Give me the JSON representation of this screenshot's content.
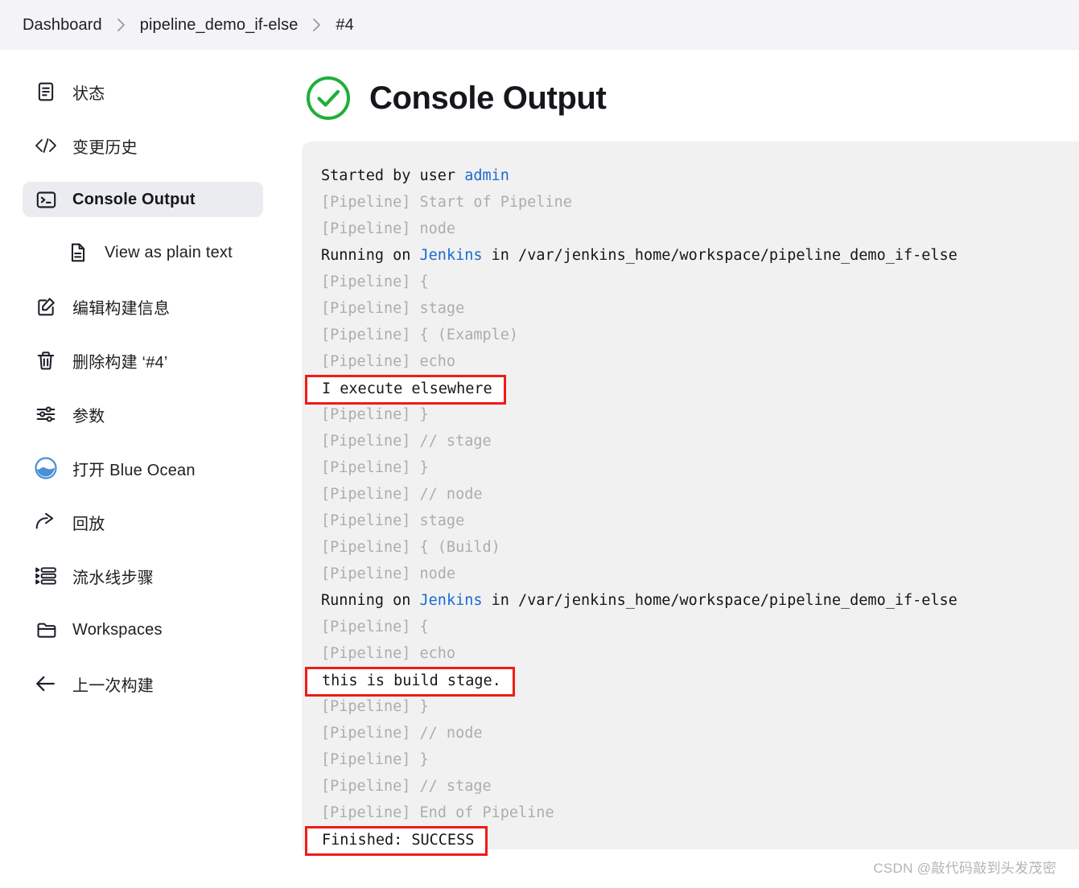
{
  "breadcrumb": {
    "items": [
      {
        "label": "Dashboard"
      },
      {
        "label": "pipeline_demo_if-else"
      },
      {
        "label": "#4"
      }
    ],
    "separator_icon": "chevron-right-icon"
  },
  "sidebar": {
    "items": [
      {
        "id": "status",
        "label": "状态",
        "icon": "document-icon",
        "selected": false,
        "sub": false
      },
      {
        "id": "changes",
        "label": "变更历史",
        "icon": "code-icon",
        "selected": false,
        "sub": false
      },
      {
        "id": "console",
        "label": "Console Output",
        "icon": "terminal-icon",
        "selected": true,
        "sub": false
      },
      {
        "id": "plaintext",
        "label": "View as plain text",
        "icon": "file-text-icon",
        "selected": false,
        "sub": true
      },
      {
        "id": "edit-build",
        "label": "编辑构建信息",
        "icon": "edit-icon",
        "selected": false,
        "sub": false
      },
      {
        "id": "delete-build",
        "label": "删除构建 ‘#4’",
        "icon": "trash-icon",
        "selected": false,
        "sub": false
      },
      {
        "id": "parameters",
        "label": "参数",
        "icon": "sliders-icon",
        "selected": false,
        "sub": false
      },
      {
        "id": "blue-ocean",
        "label": "打开 Blue Ocean",
        "icon": "blue-ocean-icon",
        "selected": false,
        "sub": false
      },
      {
        "id": "replay",
        "label": "回放",
        "icon": "replay-icon",
        "selected": false,
        "sub": false
      },
      {
        "id": "pipeline-steps",
        "label": "流水线步骤",
        "icon": "steps-icon",
        "selected": false,
        "sub": false
      },
      {
        "id": "workspaces",
        "label": "Workspaces",
        "icon": "folder-icon",
        "selected": false,
        "sub": false
      },
      {
        "id": "prev-build",
        "label": "上一次构建",
        "icon": "arrow-left-icon",
        "selected": false,
        "sub": false
      }
    ]
  },
  "main": {
    "title": "Console Output",
    "status_icon": "success-check-circle-icon",
    "status_color": "#1faf38"
  },
  "console": {
    "lines": [
      {
        "segments": [
          {
            "text": "Started by user ",
            "style": "normal"
          },
          {
            "text": "admin",
            "style": "link"
          }
        ],
        "boxed": false
      },
      {
        "segments": [
          {
            "text": "[Pipeline] Start of Pipeline",
            "style": "dim"
          }
        ],
        "boxed": false
      },
      {
        "segments": [
          {
            "text": "[Pipeline] node",
            "style": "dim"
          }
        ],
        "boxed": false
      },
      {
        "segments": [
          {
            "text": "Running on ",
            "style": "normal"
          },
          {
            "text": "Jenkins",
            "style": "link"
          },
          {
            "text": " in /var/jenkins_home/workspace/pipeline_demo_if-else",
            "style": "normal"
          }
        ],
        "boxed": false
      },
      {
        "segments": [
          {
            "text": "[Pipeline] {",
            "style": "dim"
          }
        ],
        "boxed": false
      },
      {
        "segments": [
          {
            "text": "[Pipeline] stage",
            "style": "dim"
          }
        ],
        "boxed": false
      },
      {
        "segments": [
          {
            "text": "[Pipeline] { (Example)",
            "style": "dim"
          }
        ],
        "boxed": false
      },
      {
        "segments": [
          {
            "text": "[Pipeline] echo",
            "style": "dim"
          }
        ],
        "boxed": false
      },
      {
        "segments": [
          {
            "text": "I execute elsewhere",
            "style": "normal"
          }
        ],
        "boxed": true
      },
      {
        "segments": [
          {
            "text": "[Pipeline] }",
            "style": "dim"
          }
        ],
        "boxed": false
      },
      {
        "segments": [
          {
            "text": "[Pipeline] // stage",
            "style": "dim"
          }
        ],
        "boxed": false
      },
      {
        "segments": [
          {
            "text": "[Pipeline] }",
            "style": "dim"
          }
        ],
        "boxed": false
      },
      {
        "segments": [
          {
            "text": "[Pipeline] // node",
            "style": "dim"
          }
        ],
        "boxed": false
      },
      {
        "segments": [
          {
            "text": "[Pipeline] stage",
            "style": "dim"
          }
        ],
        "boxed": false
      },
      {
        "segments": [
          {
            "text": "[Pipeline] { (Build)",
            "style": "dim"
          }
        ],
        "boxed": false
      },
      {
        "segments": [
          {
            "text": "[Pipeline] node",
            "style": "dim"
          }
        ],
        "boxed": false
      },
      {
        "segments": [
          {
            "text": "Running on ",
            "style": "normal"
          },
          {
            "text": "Jenkins",
            "style": "link"
          },
          {
            "text": " in /var/jenkins_home/workspace/pipeline_demo_if-else",
            "style": "normal"
          }
        ],
        "boxed": false
      },
      {
        "segments": [
          {
            "text": "[Pipeline] {",
            "style": "dim"
          }
        ],
        "boxed": false
      },
      {
        "segments": [
          {
            "text": "[Pipeline] echo",
            "style": "dim"
          }
        ],
        "boxed": false
      },
      {
        "segments": [
          {
            "text": "this is build stage.",
            "style": "normal"
          }
        ],
        "boxed": true
      },
      {
        "segments": [
          {
            "text": "[Pipeline] }",
            "style": "dim"
          }
        ],
        "boxed": false
      },
      {
        "segments": [
          {
            "text": "[Pipeline] // node",
            "style": "dim"
          }
        ],
        "boxed": false
      },
      {
        "segments": [
          {
            "text": "[Pipeline] }",
            "style": "dim"
          }
        ],
        "boxed": false
      },
      {
        "segments": [
          {
            "text": "[Pipeline] // stage",
            "style": "dim"
          }
        ],
        "boxed": false
      },
      {
        "segments": [
          {
            "text": "[Pipeline] End of Pipeline",
            "style": "dim"
          }
        ],
        "boxed": false
      },
      {
        "segments": [
          {
            "text": "Finished: SUCCESS",
            "style": "normal"
          }
        ],
        "boxed": true
      }
    ]
  },
  "watermark": {
    "text": "CSDN @敲代码敲到头发茂密"
  }
}
